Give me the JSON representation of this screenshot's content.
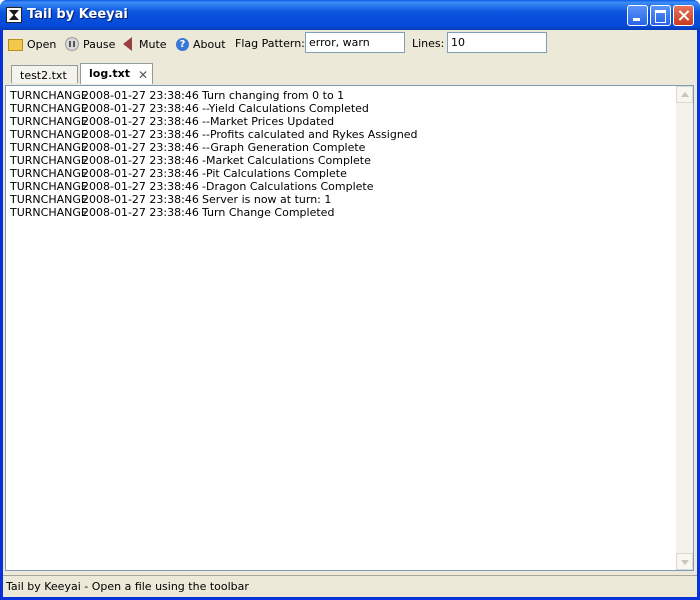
{
  "window": {
    "title": "Tail by Keeyai",
    "controls": [
      "minimize-icon",
      "maximize-icon",
      "close-icon"
    ]
  },
  "toolbar": {
    "open_label": "Open",
    "pause_label": "Pause",
    "mute_label": "Mute",
    "about_label": "About",
    "flag_pattern_label": "Flag Pattern:",
    "flag_pattern_value": "error, warn",
    "lines_label": "Lines:",
    "lines_value": "10"
  },
  "tabs": [
    {
      "label": "test2.txt",
      "active": false
    },
    {
      "label": "log.txt",
      "active": true,
      "closable": true
    }
  ],
  "log": [
    {
      "level": "TURNCHANGE",
      "timestamp": "2008-01-27 23:38:46",
      "message": "Turn changing from 0 to 1"
    },
    {
      "level": "TURNCHANGE",
      "timestamp": "2008-01-27 23:38:46",
      "message": "--Yield Calculations Completed"
    },
    {
      "level": "TURNCHANGE",
      "timestamp": "2008-01-27 23:38:46",
      "message": "--Market Prices Updated"
    },
    {
      "level": "TURNCHANGE",
      "timestamp": "2008-01-27 23:38:46",
      "message": "--Profits calculated and Rykes Assigned"
    },
    {
      "level": "TURNCHANGE",
      "timestamp": "2008-01-27 23:38:46",
      "message": "--Graph Generation Complete"
    },
    {
      "level": "TURNCHANGE",
      "timestamp": "2008-01-27 23:38:46",
      "message": "-Market Calculations Complete"
    },
    {
      "level": "TURNCHANGE",
      "timestamp": "2008-01-27 23:38:46",
      "message": "-Pit Calculations Complete"
    },
    {
      "level": "TURNCHANGE",
      "timestamp": "2008-01-27 23:38:46",
      "message": "-Dragon Calculations Complete"
    },
    {
      "level": "TURNCHANGE",
      "timestamp": "2008-01-27 23:38:46",
      "message": "Server is now at turn: 1"
    },
    {
      "level": "TURNCHANGE",
      "timestamp": "2008-01-27 23:38:46",
      "message": "Turn Change Completed"
    }
  ],
  "status_bar": {
    "text": "Tail by Keeyai - Open a file using the toolbar"
  }
}
